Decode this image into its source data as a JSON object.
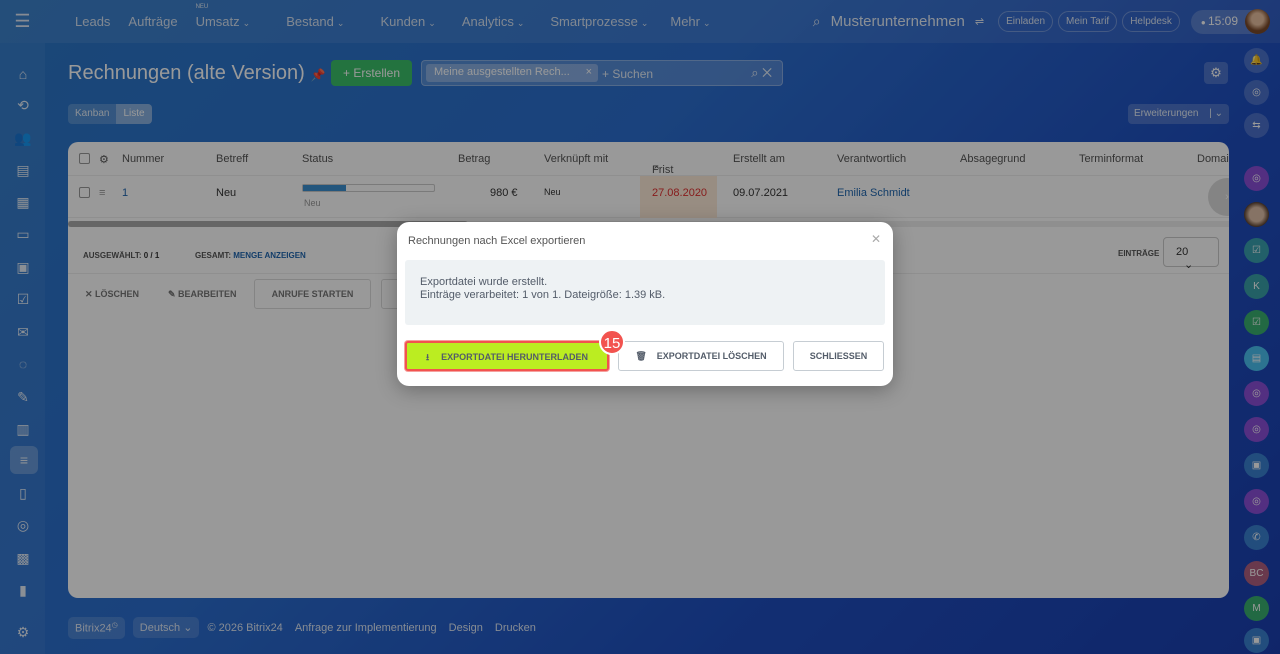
{
  "topbar": {
    "nav": [
      {
        "label": "Leads"
      },
      {
        "label": "Aufträge"
      },
      {
        "label": "Umsatz",
        "badge": "NEU"
      },
      {
        "label": "Bestand"
      },
      {
        "label": "Kunden"
      },
      {
        "label": "Analytics"
      },
      {
        "label": "Smartprozesse"
      },
      {
        "label": "Mehr"
      }
    ],
    "company": "Musterunternehmen",
    "invite": "Einladen",
    "tariff": "Mein Tarif",
    "helpdesk": "Helpdesk",
    "time": "15:09"
  },
  "page": {
    "title": "Rechnungen (alte Version)",
    "create": "Erstellen",
    "filter_chip": "Meine ausgestellten Rech...",
    "search_placeholder": "+ Suchen",
    "view_kanban": "Kanban",
    "view_list": "Liste",
    "extensions": "Erweiterungen"
  },
  "table": {
    "headers": [
      "Nummer",
      "Betreff",
      "Status",
      "Betrag",
      "Verknüpft mit",
      "Frist",
      "Erstellt am",
      "Verantwortlich",
      "Absagegrund",
      "Terminformat",
      "Domai"
    ],
    "rows": [
      {
        "nummer": "1",
        "betreff": "Neu",
        "status": "Neu",
        "status_progress": 0.33,
        "betrag": "980 €",
        "verknuepft": "Neu",
        "frist": "27.08.2020",
        "erstellt": "09.07.2021",
        "verantwortlich": "Emilia Schmidt"
      }
    ],
    "selected_label": "AUSGEWÄHLT:",
    "selected_value": "0 / 1",
    "total_label": "GESAMT:",
    "total_link": "MENGE ANZEIGEN",
    "entries_label": "EINTRÄGE",
    "entries_value": "20",
    "actions": {
      "delete": "LÖSCHEN",
      "edit": "BEARBEITEN",
      "calls": "ANRUFE STARTEN"
    }
  },
  "footer": {
    "brand": "Bitrix24",
    "language": "Deutsch",
    "copyright": "© 2026 Bitrix24",
    "impl": "Anfrage zur Implementierung",
    "design": "Design",
    "print": "Drucken"
  },
  "dialog": {
    "title": "Rechnungen nach Excel exportieren",
    "line1": "Exportdatei wurde erstellt.",
    "line2": "Einträge verarbeitet: 1 von 1. Dateigröße: 1.39 kB.",
    "download": "EXPORTDATEI HERUNTERLADEN",
    "delete": "EXPORTDATEI LÖSCHEN",
    "close": "SCHLIESSEN",
    "step_badge": "15"
  },
  "right_sidebar": {
    "initials": [
      "K",
      "BC",
      "M"
    ]
  },
  "colors": {
    "accent_green": "#bbed21",
    "highlight_red": "#f2534f",
    "create_green": "#3bc06a"
  }
}
